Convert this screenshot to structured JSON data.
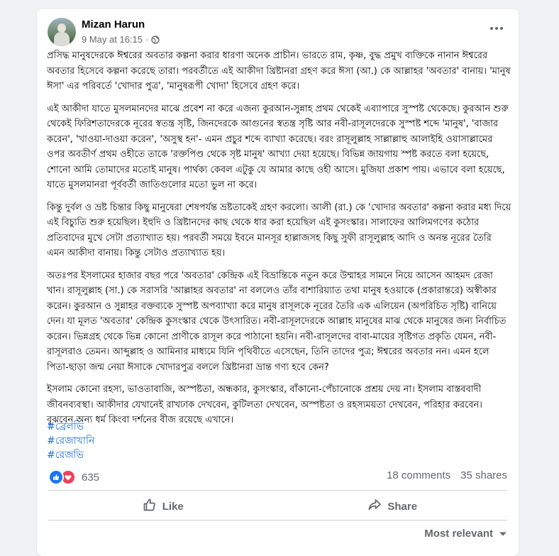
{
  "post": {
    "author": "Mizan Harun",
    "timestamp": "9 May at 16:15",
    "separator": "·",
    "privacy_icon": "globe-icon",
    "paragraphs": [
      "প্রসিদ্ধ মানুষদেরকে ঈশ্বরের অবতার কল্পনা করার ধারণা অনেক প্রাচীন। ভারতে রাম, কৃষ্ণ, বুদ্ধ প্রমুখ ব্যক্তিকে নানান ঈশ্বরের অবতার হিসেবে কল্পনা করেছে তারা। পরবর্তীতে এই আকীদা খ্রিষ্টানরা গ্রহণ করে ঈসা (আ.) কে আল্লাহর 'অবতার' বানায়। 'মানুষ ঈসা' এর পরিবর্তে 'খোদার পুত্র', 'মানুষরূপী খোদা' হিসেবে গ্রহণ করে।",
      "এই আকীদা যাতে মুসলমানদের মাঝে প্রবেশ না করে এজন্য কুরআন-সুন্নাহ প্রথম থেকেই এব্যাপারে সুস্পষ্ট থেকেছে। কুরআন শুরু থেকেই ফিরিশতাদেরকে নূরের স্বতন্ত্র সৃষ্টি, জিনদেরকে আগুনের স্বতন্ত্র সৃষ্টি আর নবী-রাসূলদেরকে সুস্পষ্ট শব্দে 'মানুষ', 'বাজার করেন', 'খাওয়া-দাওয়া করেন', 'অসুস্থ হন'- এমন প্রচুর শব্দে ব্যাখ্যা করেছে। বরং রাসূলুল্লাহ সাল্লাল্লাহু আলাইহি ওয়াসাল্লামের ওপর অবতীর্ণ প্রথম ওহীতে তাকে 'রক্তপিণ্ড থেকে সৃষ্ট মানুষ' আখ্যা দেয়া হয়েছে। বিভিন্ন জায়গায় স্পষ্ট করতে বলা হয়েছে, শোনো আমি তোমাদের মতোই মানুষ। পার্থক্য কেবল এটুকু যে আমার কাছে ওহী আসে। মুজিযা প্রকাশ পায়। এভাবে বলা হয়েছে, যাতে মুসলমানরা পূর্ববর্তী জাতিগুলোর মতো ভুল না করে।",
      "কিন্তু দুর্বল ও ভ্রষ্ট চিন্তার কিছু মানুষেরা শেষপর্যন্ত ভ্রষ্টতাকেই গ্রহণ করলো। আলী (রা.) কে 'খোদার অবতার' কল্পনা করার মধ্য দিয়ে এই বিচ্যুতি শুরু হয়েছিল। ইহুদি ও খ্রিষ্টানদের কাছ থেকে ধার করা হয়েছিল এই কুসংস্কার। সালাফের আলিমগণের কঠোর প্রতিবাদের মুখে সেটা প্রত্যাখ্যাত হয়। পরবর্তী সময়ে ইবনে মানসূর হাল্লাজসহ কিছু সুফী রাসূলুল্লাহ আদি ও অনন্ত নূরের তৈরি এমন আকীদা বানায়। কিন্তু সেটাও প্রত্যাখ্যাত হয়।",
      "অতঃপর ইসলামের হাজার বছর পরে 'অবতার' কেন্দ্রিক এই বিভ্রান্তিকে নতুন করে উম্মাহর সামনে নিয়ে আসেন আহমদ রেজা খান। রাসূলুল্লাহ (সা.) কে সরাসরি 'আল্লাহর অবতার' না বললেও তাঁর বাশারিয়্যাত তথা মানুষ হওয়াকে (প্রকারান্তরে) অস্বীকার করেন। কুরআন ও সুন্নাহর বক্তব্যকে সুস্পষ্ট অপব্যাখ্যা করে মানুষ রাসূলকে নূরের তৈরি এক এলিয়েন (অপরিচিত সৃষ্টি) বানিয়ে দেন। যা মূলত 'অবতার' কেন্দ্রিক কুসংস্কার থেকে উৎসারিত। নবী-রাসূলদেরকে আল্লাহ মানুষের মাঝ থেকে মানুষের জন্য নির্বাচিত করেন। ভিন্নগ্রহ থেকে ভিন্ন কোনো প্রাণীকে রাসূল করে পাঠানো হয়নি। নবী-রাসূলদের বাবা-মায়ের সৃষ্টিগত প্রকৃতি যেমন, নবী-রাসূলরাও তেমন। আব্দুল্লাহ ও আমিনার মাধ্যমে যিনি পৃথিবীতে এসেছেন, তিনি তাদের পুত্র; ঈশ্বরের অবতার নন। এমন হলে পিতা-ছাড়া জন্ম নেয়া ঈসাকে খোদারপুত্র বললে খ্রিষ্টানরা ভ্রান্ত গণ্য হবে কেন?",
      "ইসলাম কোনো রহস্য, ভাওতাবাজি, অস্পষ্টতা, অন্ধকার, কুসংস্কার, বাঁকানো-পেঁচানোকে প্রশ্রয় দেয় না। ইসলাম বাস্তববাদী জীবনব্যবস্থা। আকীদার যেখানেই রাখঢাক দেখবেন, কুটিলতা দেখবেন, অস্পষ্টতা ও রহস্যময়তা দেখবেন, পরিহার করবেন। বুঝবেন অন্য ধর্ম কিংবা দর্শনের বীজ রয়েছে এখানে।"
    ],
    "hashtags": [
      "#ব্রেলভি",
      "#রেজাখানি",
      "#রেজভি"
    ]
  },
  "stats": {
    "reaction_icons": [
      "like-icon",
      "love-icon"
    ],
    "reaction_count": "635",
    "comments": "18 comments",
    "shares": "35 shares"
  },
  "actions": {
    "like_label": "Like",
    "share_label": "Share"
  },
  "comments_sort": {
    "label": "Most relevant"
  },
  "colors": {
    "background": "#f0f2f5",
    "card": "#ffffff",
    "link": "#216fdb",
    "secondary_text": "#65676b",
    "like_blue": "#1877f2",
    "love_red": "#f33e58"
  }
}
